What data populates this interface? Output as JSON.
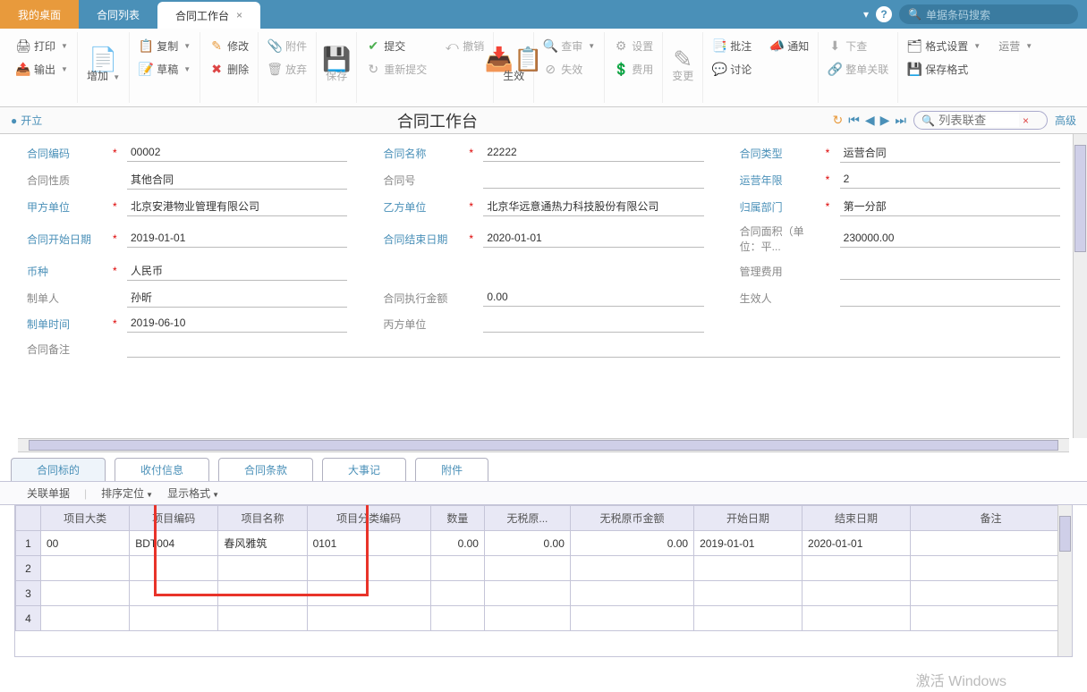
{
  "top_tabs": {
    "desktop": "我的桌面",
    "list": "合同列表",
    "workbench": "合同工作台"
  },
  "top_search_placeholder": "单据条码搜索",
  "ribbon": {
    "print": "打印",
    "output": "输出",
    "add": "增加",
    "copy": "复制",
    "draft": "草稿",
    "modify": "修改",
    "delete": "删除",
    "attach": "附件",
    "discard": "放弃",
    "save": "保存",
    "submit": "提交",
    "resubmit": "重新提交",
    "cancel_submit": "撤销",
    "take_effect": "生效",
    "review": "查审",
    "void": "失效",
    "settings": "设置",
    "fee": "费用",
    "change": "变更",
    "batch": "批注",
    "discuss": "讨论",
    "notify": "通知",
    "download": "下查",
    "link_all": "整单关联",
    "format": "格式设置",
    "save_format": "保存格式",
    "biz_label": "运营"
  },
  "status": {
    "state": "开立",
    "page_title": "合同工作台",
    "advanced": "高级",
    "list_search_placeholder": "列表联查"
  },
  "form": {
    "labels": {
      "code": "合同编码",
      "name": "合同名称",
      "type": "合同类型",
      "nature": "合同性质",
      "number": "合同号",
      "years": "运营年限",
      "partyA": "甲方单位",
      "partyB": "乙方单位",
      "dept": "归属部门",
      "start": "合同开始日期",
      "end": "合同结束日期",
      "area": "合同面积（单位：平...",
      "currency": "币种",
      "mgmt_fee": "管理费用",
      "creator": "制单人",
      "exec_amount": "合同执行金额",
      "approver": "生效人",
      "create_time": "制单时间",
      "partyC": "丙方单位",
      "remark": "合同备注"
    },
    "values": {
      "code": "00002",
      "name": "22222",
      "type": "运营合同",
      "nature": "其他合同",
      "number": "",
      "years": "2",
      "partyA": "北京安港物业管理有限公司",
      "partyB": "北京华远意通热力科技股份有限公司",
      "dept": "第一分部",
      "start": "2019-01-01",
      "end": "2020-01-01",
      "area": "230000.00",
      "currency": "人民币",
      "mgmt_fee": "",
      "creator": "孙昕",
      "exec_amount": "0.00",
      "approver": "",
      "create_time": "2019-06-10",
      "partyC": "",
      "remark": ""
    }
  },
  "detail_tabs": {
    "t1": "合同标的",
    "t2": "收付信息",
    "t3": "合同条款",
    "t4": "大事记",
    "t5": "附件"
  },
  "toolbar2": {
    "assoc": "关联单据",
    "sort": "排序定位",
    "display": "显示格式"
  },
  "grid": {
    "headers": {
      "cat": "项目大类",
      "code": "项目编码",
      "name": "项目名称",
      "class_code": "项目分类编码",
      "qty": "数量",
      "price": "无税原...",
      "amount": "无税原币金额",
      "start": "开始日期",
      "end": "结束日期",
      "remark": "备注"
    },
    "row1": {
      "idx": "1",
      "cat": "00",
      "code": "BDT004",
      "name": "春风雅筑",
      "class_code": "0101",
      "qty": "0.00",
      "price": "0.00",
      "amount": "0.00",
      "start": "2019-01-01",
      "end": "2020-01-01",
      "remark": ""
    },
    "row2_idx": "2",
    "row3_idx": "3",
    "row4_idx": "4"
  },
  "watermark": "激活 Windows"
}
